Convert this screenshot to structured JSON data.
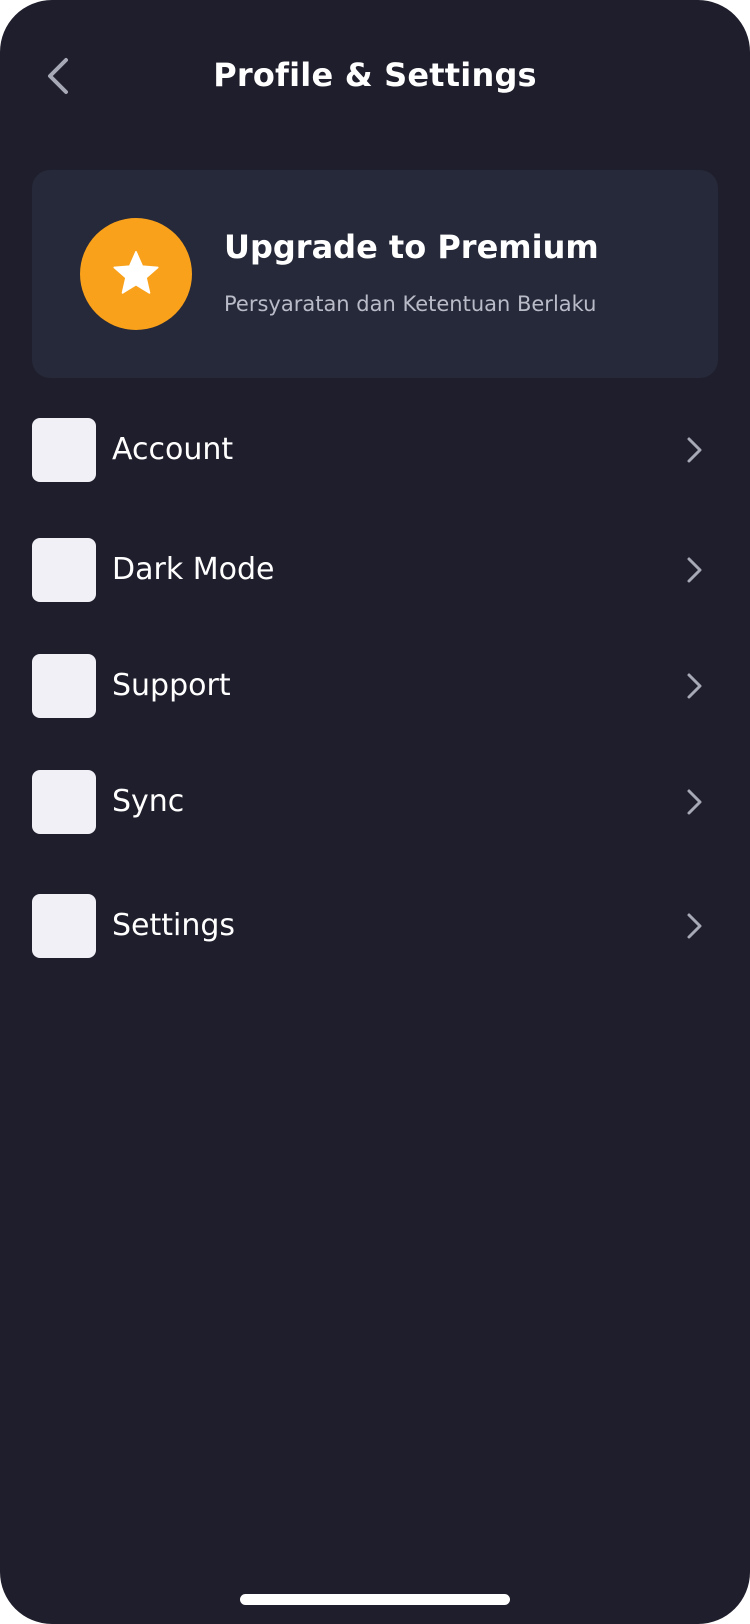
{
  "header": {
    "title": "Profile & Settings",
    "back_icon": "chevron-left-icon"
  },
  "premium": {
    "title": "Upgrade to Premium",
    "subtitle": "Persyaratan dan Ketentuan Berlaku",
    "icon": "star-icon",
    "accent_color": "#f9a11b"
  },
  "menu": {
    "items": [
      {
        "label": "Account",
        "icon": "account-icon"
      },
      {
        "label": "Dark Mode",
        "icon": "dark-mode-icon"
      },
      {
        "label": "Support",
        "icon": "support-icon"
      },
      {
        "label": "Sync",
        "icon": "sync-icon"
      },
      {
        "label": "Settings",
        "icon": "settings-icon"
      }
    ]
  },
  "colors": {
    "background": "#1f1e2c",
    "card": "#262939",
    "icon_tile": "#f1f0f6",
    "text_secondary": "#b9bbc8"
  }
}
